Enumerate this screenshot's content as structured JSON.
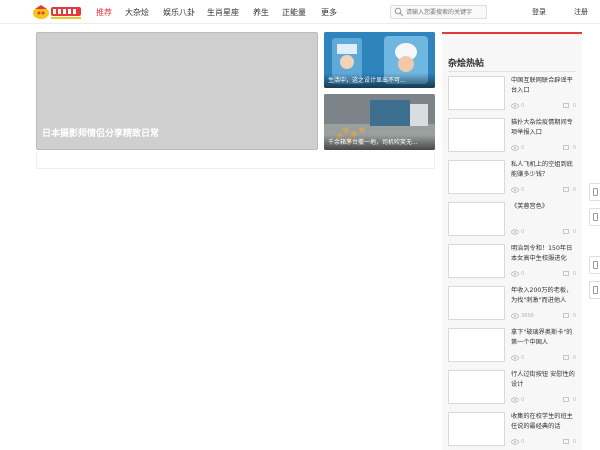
{
  "header": {
    "nav": [
      "推荐",
      "大杂烩",
      "娱乐八卦",
      "生肖星座",
      "养生",
      "正能量",
      "更多"
    ],
    "search_placeholder": "请输入您要搜索的关键字",
    "login": "登录",
    "register": "注册",
    "accent": "#e4393c"
  },
  "featured": {
    "hero_caption": "日本摄影师情侣分享精致日常",
    "thumb1_caption": "生活中，这之设计显出不可...",
    "thumb2_caption": "千余箱茅台撒一地，司机吹笑无..."
  },
  "sidebar": {
    "title": "杂烩热帖",
    "items": [
      {
        "title": "中国互联网联合辟谣平台入口",
        "views": "0",
        "comments": "0"
      },
      {
        "title": "猫扑大杂烩疫情期间专项举报入口",
        "views": "0",
        "comments": "0"
      },
      {
        "title": "私人飞机上的空姐到底能赚多少钱？",
        "views": "0",
        "comments": "0"
      },
      {
        "title": "《芙蓉宫色》",
        "views": "0",
        "comments": "0"
      },
      {
        "title": "明治到令和！150年日本女高中生校服进化",
        "views": "0",
        "comments": "0"
      },
      {
        "title": "年收入200万的老板，为找\"刺激\"而进他人",
        "views": "3888",
        "comments": "0"
      },
      {
        "title": "拿下\"玻璃界奥斯卡\"的第一个中国人",
        "views": "0",
        "comments": "0"
      },
      {
        "title": "行人过街按钮 安慰性的设计",
        "views": "0",
        "comments": "0"
      },
      {
        "title": "收集的在校学生的班主任说的最经典的话",
        "views": "0",
        "comments": "0"
      }
    ]
  }
}
